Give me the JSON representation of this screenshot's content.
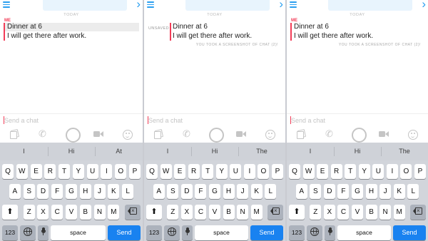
{
  "panels": [
    {
      "chat": {
        "day_label": "TODAY",
        "sender": "ME",
        "saved_label": "",
        "messages": [
          "Dinner at 6",
          "I will get there after work."
        ],
        "screenshot_note": "",
        "input_placeholder": "Send a chat"
      },
      "suggestions": [
        "I",
        "Hi",
        "At"
      ]
    },
    {
      "chat": {
        "day_label": "TODAY",
        "sender": "",
        "saved_label": "UNSAVED",
        "messages": [
          "Dinner at 6",
          "I will get there after work."
        ],
        "screenshot_note": "YOU TOOK A SCREENSHOT OF CHAT (2)!",
        "input_placeholder": "Send a chat"
      },
      "suggestions": [
        "I",
        "Hi",
        "The"
      ]
    },
    {
      "chat": {
        "day_label": "TODAY",
        "sender": "ME",
        "saved_label": "",
        "messages": [
          "Dinner at 6",
          "I will get there after work."
        ],
        "screenshot_note": "YOU TOOK A SCREENSHOT OF CHAT (2)!",
        "input_placeholder": "Send a chat"
      },
      "suggestions": [
        "I",
        "Hi",
        "The"
      ]
    }
  ],
  "keyboard": {
    "row1": [
      "Q",
      "W",
      "E",
      "R",
      "T",
      "Y",
      "U",
      "I",
      "O",
      "P"
    ],
    "row2": [
      "A",
      "S",
      "D",
      "F",
      "G",
      "H",
      "J",
      "K",
      "L"
    ],
    "row3": [
      "Z",
      "X",
      "C",
      "V",
      "B",
      "N",
      "M"
    ],
    "numbers_label": "123",
    "space_label": "space",
    "send_label": "Send"
  },
  "icons": {
    "menu": "hamburger-menu-icon",
    "next": "chevron-right-icon",
    "gallery": "memories-icon",
    "call": "phone-icon",
    "capture": "camera-capture-icon",
    "video": "video-call-icon",
    "emoji": "emoji-icon",
    "shift": "shift-icon",
    "backspace": "backspace-icon",
    "globe": "globe-icon",
    "mic": "microphone-icon"
  },
  "colors": {
    "accent_red": "#f23c57",
    "accent_blue": "#2a9ff0",
    "send_blue": "#1982f0",
    "keyboard_bg": "#d2d5db"
  }
}
